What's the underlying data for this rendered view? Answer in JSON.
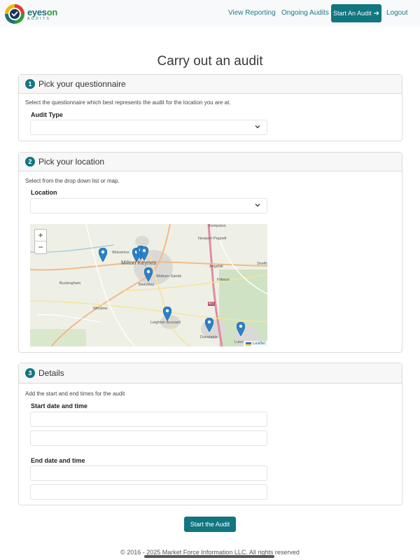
{
  "brand": {
    "name_main": "eyes",
    "name_accent": "on",
    "tagline": "AUDITS"
  },
  "nav": {
    "view_reporting": "View Reporting",
    "ongoing_audits": "Ongoing Audits",
    "start_audit": "Start An Audit",
    "logout": "Logout"
  },
  "page_title": "Carry out an audit",
  "sections": {
    "questionnaire": {
      "step": "1",
      "title": "Pick your questionnaire",
      "description": "Select the questionnaire which best represents the audit for the location you are at.",
      "field_label": "Audit Type",
      "value": ""
    },
    "location": {
      "step": "2",
      "title": "Pick your location",
      "description": "Select from the drop down list or map.",
      "field_label": "Location",
      "value": ""
    },
    "details": {
      "step": "3",
      "title": "Details",
      "description": "Add the start and end times for the audit",
      "start_label": "Start date and time",
      "end_label": "End date and time"
    }
  },
  "map": {
    "zoom_in": "+",
    "zoom_out": "−",
    "attribution": "Leaflet",
    "place_labels": [
      "Kempston",
      "Newport Pagnell",
      "Wolverton",
      "Milton Keynes",
      "Ampthill",
      "Shefford",
      "Woburn Sands",
      "Bletchley",
      "Flitwick",
      "Buckingham",
      "Winslow",
      "Leighton Buzzard",
      "Dunstable",
      "Luton"
    ],
    "road_label": "M1",
    "marker_count": 7
  },
  "submit_label": "Start the Audit",
  "footer": "© 2016 - 2025 Market Force Information LLC. All rights reserved",
  "colors": {
    "primary": "#117680",
    "link": "#1a7b86",
    "marker": "#2a81cb"
  }
}
